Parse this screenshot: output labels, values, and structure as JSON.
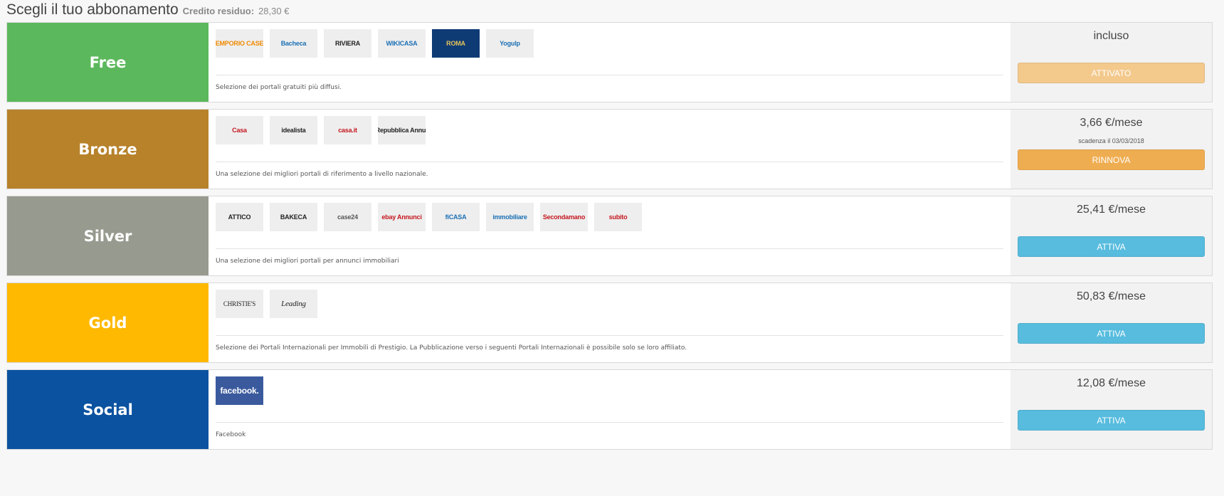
{
  "header": {
    "title": "Scegli il tuo abbonamento",
    "credit_label": "Credito residuo:",
    "credit_value": "28,30 €"
  },
  "colors": {
    "free": "#5cb85c",
    "bronze": "#b8822b",
    "silver": "#979a8e",
    "gold": "#ffb900",
    "social": "#0b52a0",
    "attivato": "#f3c98c",
    "rinnova": "#efad51",
    "attiva": "#57bcde"
  },
  "plans": [
    {
      "name": "Free",
      "logos": [
        "EMPORIO CASE",
        "Bacheca",
        "RIVIERA",
        "WIKICASA",
        "ROMA",
        "Yogulp"
      ],
      "description": "Selezione dei portali gratuiti più diffusi.",
      "price": "incluso",
      "expiry": "",
      "button": "ATTIVATO"
    },
    {
      "name": "Bronze",
      "logos": [
        "Casa",
        "idealista",
        "casa.it",
        "la Repubblica Annunci"
      ],
      "description": "Una selezione dei migliori portali di riferimento a livello nazionale.",
      "price": "3,66 €/mese",
      "expiry": "scadenza il 03/03/2018",
      "button": "RINNOVA"
    },
    {
      "name": "Silver",
      "logos": [
        "ATTICO",
        "BAKECA",
        "case24",
        "ebay Annunci",
        "fiCASA",
        "immobiliare",
        "Secondamano",
        "subito"
      ],
      "description": "Una selezione dei migliori portali per annunci immobiliari",
      "price": "25,41 €/mese",
      "expiry": "",
      "button": "ATTIVA"
    },
    {
      "name": "Gold",
      "logos": [
        "CHRISTIE'S",
        "Leading"
      ],
      "description": "Selezione dei Portali Internazionali per Immobili di Prestigio. La Pubblicazione verso i seguenti Portali Internazionali è possibile solo se loro affiliato.",
      "price": "50,83 €/mese",
      "expiry": "",
      "button": "ATTIVA"
    },
    {
      "name": "Social",
      "logos": [
        "facebook."
      ],
      "description": "Facebook",
      "price": "12,08 €/mese",
      "expiry": "",
      "button": "ATTIVA"
    }
  ]
}
